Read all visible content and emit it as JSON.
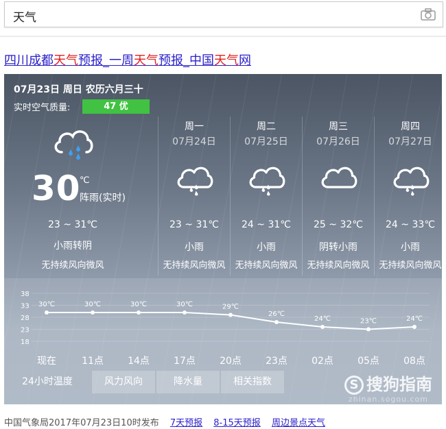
{
  "search": {
    "query": "天气"
  },
  "result": {
    "title_parts": [
      "四川成都",
      "天气",
      "预报_一周",
      "天气",
      "预报_中国",
      "天气",
      "网"
    ]
  },
  "card": {
    "date": "07月23日 周日 农历六月三十",
    "aqi_label": "实时空气质量:",
    "aqi_value": "47 优",
    "aqi_color": "#41c242",
    "today": {
      "temp": "30",
      "unit": "℃",
      "now_desc": "阵雨(实时)",
      "range": "23 ~ 31℃",
      "cond": "小雨转阴",
      "wind": "无持续风向微风",
      "icon": "rain-cloud-icon"
    },
    "forecast": [
      {
        "weekday": "周一",
        "date": "07月24日",
        "range": "23 ~ 31℃",
        "cond": "小雨",
        "wind": "无持续风向微风",
        "icon": "rain-cloud-icon"
      },
      {
        "weekday": "周二",
        "date": "07月25日",
        "range": "24 ~ 31℃",
        "cond": "小雨",
        "wind": "无持续风向微风",
        "icon": "rain-cloud-icon"
      },
      {
        "weekday": "周三",
        "date": "07月26日",
        "range": "25 ~ 32℃",
        "cond": "阴转小雨",
        "wind": "无持续风向微风",
        "icon": "cloud-icon"
      },
      {
        "weekday": "周四",
        "date": "07月27日",
        "range": "24 ~ 33℃",
        "cond": "小雨",
        "wind": "无持续风向微风",
        "icon": "rain-cloud-icon"
      }
    ],
    "tabs": [
      "24小时温度",
      "风力风向",
      "降水量",
      "相关指数"
    ],
    "brand": "搜狗指南",
    "brand_sub": "zhinan.sogou.com"
  },
  "chart_data": {
    "type": "line",
    "x": [
      "现在",
      "11点",
      "14点",
      "17点",
      "20点",
      "23点",
      "02点",
      "05点",
      "08点"
    ],
    "series": [
      {
        "values": [
          30,
          30,
          30,
          30,
          29,
          26,
          24,
          23,
          24
        ]
      }
    ],
    "point_labels": [
      "30℃",
      "30℃",
      "30℃",
      "30℃",
      "29℃",
      "26℃",
      "24℃",
      "23℃",
      "24℃"
    ],
    "y_ticks": [
      18,
      23,
      28,
      33,
      38
    ],
    "ylim": [
      18,
      38
    ],
    "grid": true
  },
  "footer": {
    "source": "中国气象局2017年07月23日10时发布",
    "links": [
      "7天预报",
      "8-15天预报",
      "周边景点天气"
    ]
  }
}
